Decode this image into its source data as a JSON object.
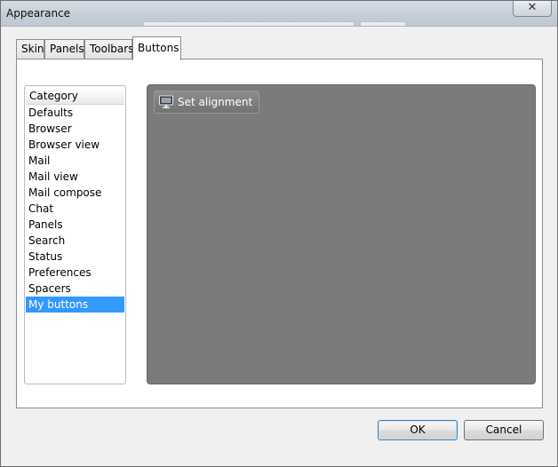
{
  "window": {
    "title": "Appearance",
    "close_glyph": "✕"
  },
  "tabs": [
    {
      "label": "Skin",
      "active": false
    },
    {
      "label": "Panels",
      "active": false
    },
    {
      "label": "Toolbars",
      "active": false
    },
    {
      "label": "Buttons",
      "active": true
    }
  ],
  "category_list": {
    "header": "Category",
    "items": [
      "Defaults",
      "Browser",
      "Browser view",
      "Mail",
      "Mail view",
      "Mail compose",
      "Chat",
      "Panels",
      "Search",
      "Status",
      "Preferences",
      "Spacers",
      "My buttons"
    ],
    "selected": "My buttons"
  },
  "buttons_panel": {
    "items": [
      {
        "label": "Set alignment",
        "icon": "monitor-icon"
      }
    ]
  },
  "footer": {
    "ok_label": "OK",
    "cancel_label": "Cancel"
  },
  "colors": {
    "selection": "#3399ff",
    "canvas": "#7b7b7b"
  }
}
